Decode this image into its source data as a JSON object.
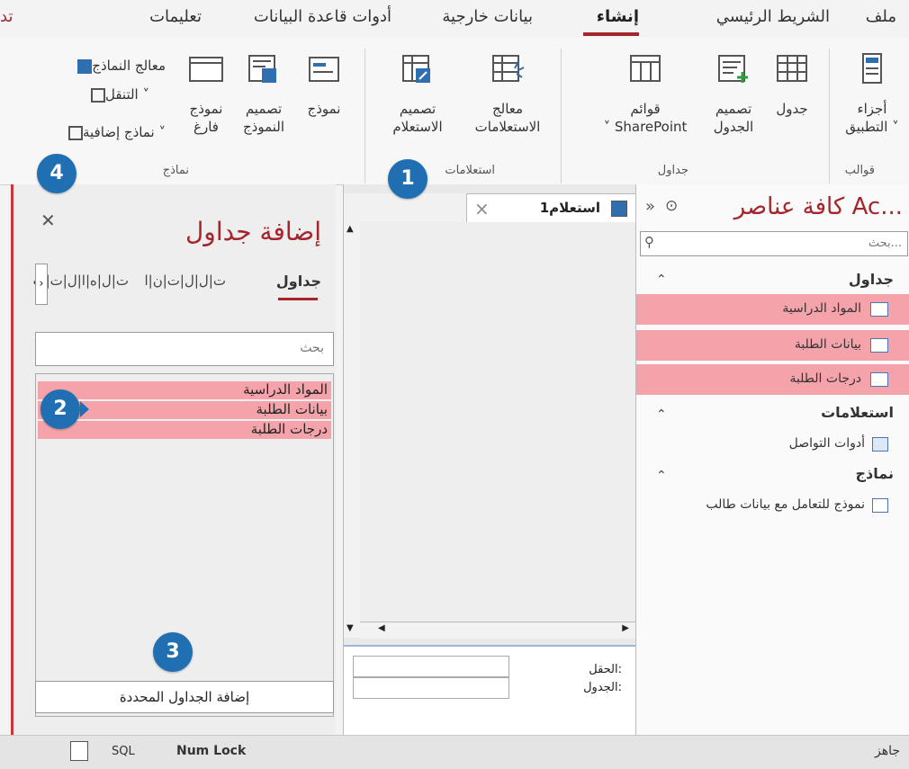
{
  "menu": {
    "file": "ملف",
    "home": "الشريط الرئيسي",
    "create": "إنشاء",
    "external": "بيانات خارجية",
    "db_tools": "أدوات قاعدة البيانات",
    "help": "تعليمات",
    "cut_tab": "تد"
  },
  "ribbon": {
    "templates": {
      "label": "قوالب",
      "app_parts_1": "أجزاء",
      "app_parts_2": "التطبيق ˅"
    },
    "tables": {
      "label": "جداول",
      "table": "جدول",
      "table_design_1": "تصميم",
      "table_design_2": "الجدول",
      "sharepoint_1": "قوائم",
      "sharepoint_2": "˅ SharePoint"
    },
    "queries": {
      "label": "استعلامات",
      "wizard_1": "معالج",
      "wizard_2": "الاستعلامات",
      "design_1": "تصميم",
      "design_2": "الاستعلام"
    },
    "forms": {
      "label": "نماذج",
      "form": "نموذج",
      "form_design_1": "تصميم",
      "form_design_2": "النموذج",
      "blank_1": "نموذج",
      "blank_2": "فارغ",
      "form_wizard": "معالج النماذج",
      "navigation": "التنقل ˅",
      "more_forms": "نماذج إضافية ˅"
    }
  },
  "nav_pane": {
    "title": "كافة عناصر Ac...",
    "search_placeholder": "بحث...",
    "tables_header": "جداول",
    "tables": [
      "المواد الدراسية",
      "بيانات الطلبة",
      "درجات الطلبة"
    ],
    "queries_header": "استعلامات",
    "queries": [
      "أدوات التواصل"
    ],
    "forms_header": "نماذج",
    "forms": [
      "نموذج للتعامل مع بيانات طالب"
    ]
  },
  "query_tab": {
    "label": "استعلام1"
  },
  "field_grid": {
    "field_label": "الحقل:",
    "table_label": "الجدول:"
  },
  "add_tables": {
    "title": "إضافة جداول",
    "tabs": [
      "جداول",
      "ت|ل|ل|ت|ن|ا",
      "ت|ل|ه|ا|ل|ت|ب"
    ],
    "search_placeholder": "بحث",
    "items": [
      "المواد الدراسية",
      "بيانات الطلبة",
      "درجات الطلبة"
    ],
    "add_button": "إضافة الجداول المحددة"
  },
  "status": {
    "ready": "جاهز",
    "num_lock": "Num Lock",
    "sql": "SQL"
  },
  "badges": [
    "1",
    "2",
    "3",
    "4"
  ],
  "colors": {
    "accent": "#a4262c",
    "highlight": "#f4a3aa",
    "badge": "#1f6fb2"
  }
}
